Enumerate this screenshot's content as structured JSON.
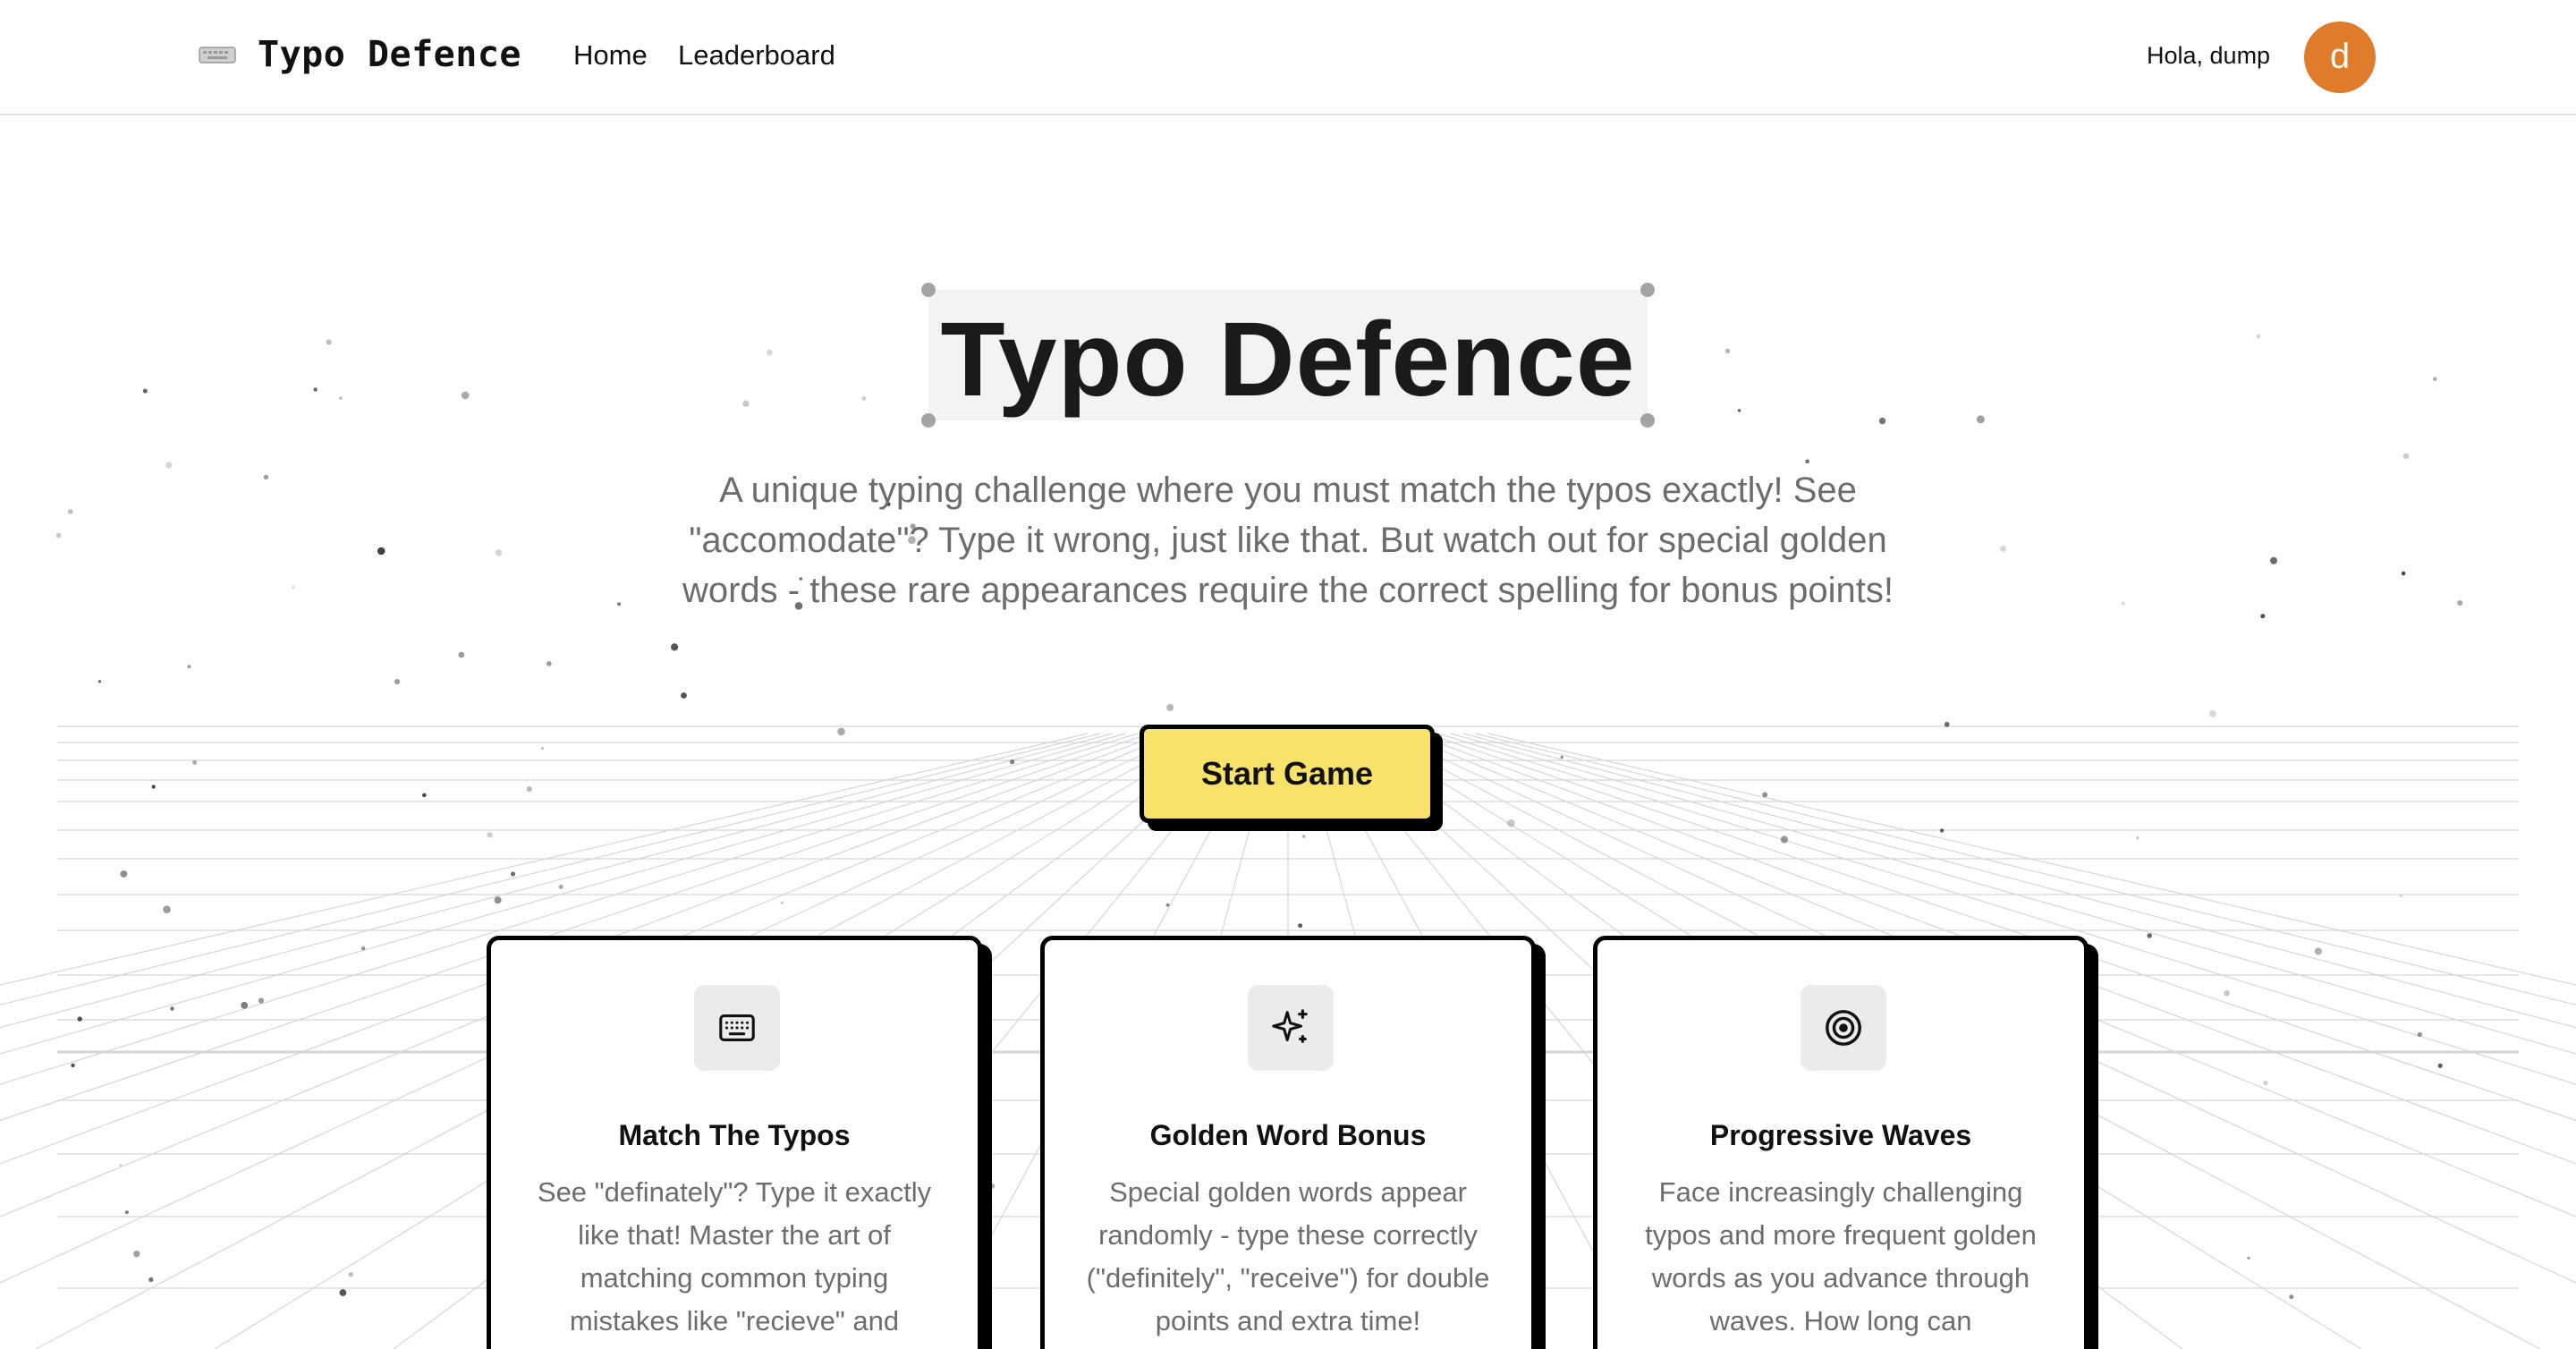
{
  "header": {
    "logo_icon": "keyboard-icon",
    "logo_text": "Typo Defence",
    "nav": [
      {
        "label": "Home"
      },
      {
        "label": "Leaderboard"
      }
    ],
    "greeting": "Hola, dump",
    "avatar_initial": "d",
    "avatar_color": "#e07b2c"
  },
  "hero": {
    "title": "Typo Defence",
    "description": "A unique typing challenge where you must match the typos exactly! See \"accomodate\"? Type it wrong, just like that. But watch out for special golden words - these rare appearances require the correct spelling for bonus points!",
    "cta_label": "Start Game",
    "cta_color": "#f9e26a"
  },
  "features": [
    {
      "icon": "keyboard-icon",
      "title": "Match The Typos",
      "description": "See \"definately\"? Type it exactly like that! Master the art of matching common typing mistakes like \"recieve\" and"
    },
    {
      "icon": "sparkle-icon",
      "title": "Golden Word Bonus",
      "description": "Special golden words appear randomly - type these correctly (\"definitely\", \"receive\") for double points and extra time!"
    },
    {
      "icon": "target-icon",
      "title": "Progressive Waves",
      "description": "Face increasingly challenging typos and more frequent golden words as you advance through waves. How long can"
    }
  ]
}
